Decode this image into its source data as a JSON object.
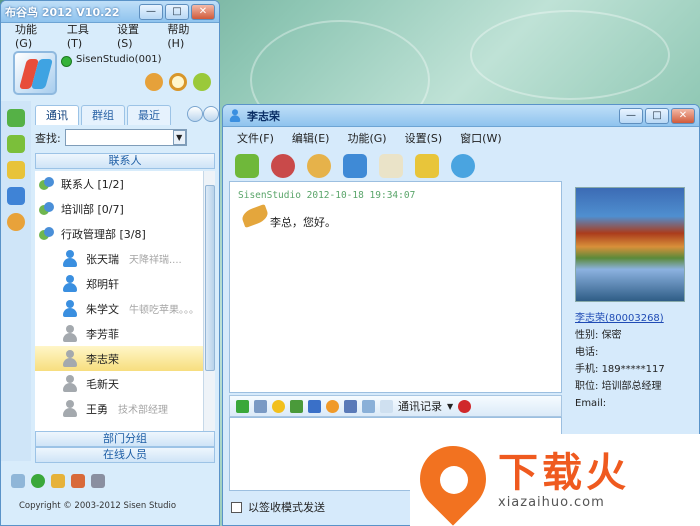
{
  "main_window": {
    "title": "布谷鸟 2012  V10.22",
    "menu": [
      "功能(G)",
      "工具(T)",
      "设置(S)",
      "帮助(H)"
    ],
    "profile_name": "SisenStudio(001)",
    "tabs": [
      "通讯",
      "群组",
      "最近"
    ],
    "search_label": "查找:",
    "search_value": "",
    "section_contacts": "联系人",
    "groups": [
      {
        "label": "联系人 [1/2]"
      },
      {
        "label": "培训部 [0/7]"
      },
      {
        "label": "行政管理部 [3/8]"
      }
    ],
    "members": [
      {
        "name": "张天瑞",
        "signature": "天降祥瑞....",
        "online": true
      },
      {
        "name": "郑明轩",
        "signature": "",
        "online": true
      },
      {
        "name": "朱学文",
        "signature": "牛顿吃苹果。。。",
        "online": true
      },
      {
        "name": "李芳菲",
        "signature": "",
        "online": false
      },
      {
        "name": "李志荣",
        "signature": "",
        "online": false,
        "selected": true
      },
      {
        "name": "毛新天",
        "signature": "",
        "online": false
      },
      {
        "name": "王勇",
        "signature": "技术部经理",
        "online": false
      }
    ],
    "section_departments": "部门分组",
    "section_online": "在线人员",
    "copyright": "Copyright © 2003-2012 Sisen Studio"
  },
  "chat_window": {
    "title": "李志荣",
    "menu": [
      "文件(F)",
      "编辑(E)",
      "功能(G)",
      "设置(S)",
      "窗口(W)"
    ],
    "message_meta": "SisenStudio 2012-10-18 19:34:07",
    "message_text": "李总，您好。",
    "contact_link": "李志荣(80003268)",
    "gender_label": "性别:",
    "gender_value": "保密",
    "phone_label": "电话:",
    "phone_value": "",
    "mobile_label": "手机:",
    "mobile_value": "189*****117",
    "position_label": "职位:",
    "position_value": "培训部总经理",
    "email_label": "Email:",
    "history_button": "通讯记录",
    "receipt_mode": "以签收模式发送"
  },
  "watermark": {
    "brand": "下载火",
    "url": "xiazaihuo.com"
  },
  "colors": {
    "accent": "#3a8fe0",
    "titlebar": "#8fc3ee",
    "selected_row": "#f7de7e",
    "watermark": "#ef5a1f"
  }
}
